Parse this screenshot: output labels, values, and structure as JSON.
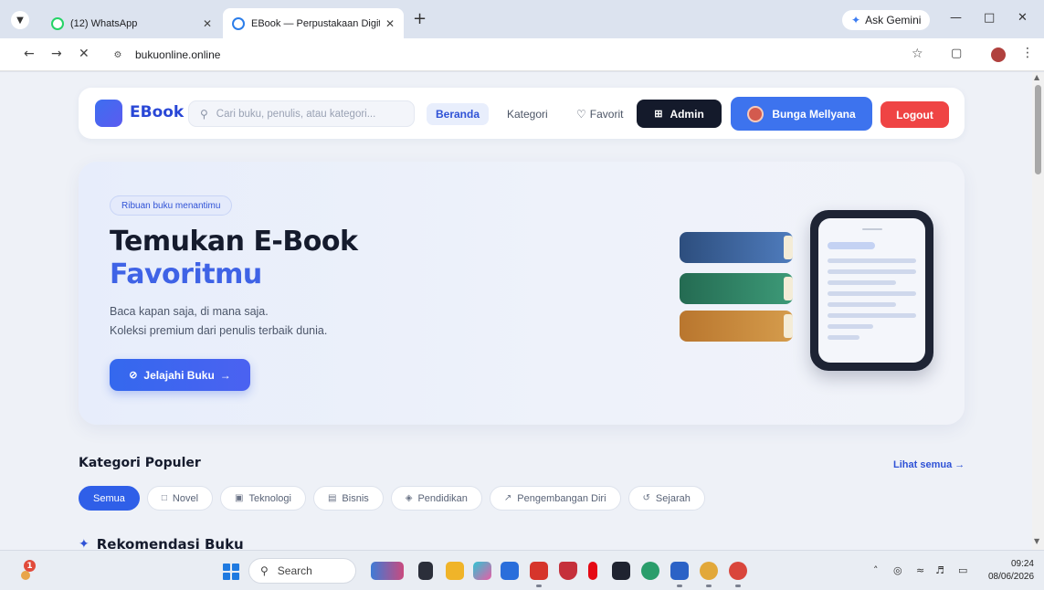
{
  "browser": {
    "tabs": [
      {
        "title": "(12) WhatsApp",
        "active": false
      },
      {
        "title": "EBook — Perpustakaan Digital",
        "active": true
      }
    ],
    "ask_gemini": "Ask Gemini",
    "url": "bukuonline.online"
  },
  "nav": {
    "logo": "EBook",
    "search_placeholder": "Cari buku, penulis, atau kategori...",
    "links": [
      "Beranda",
      "Kategori",
      "Favorit"
    ],
    "admin_label": "Admin",
    "user_label": "Bunga Mellyana",
    "logout_label": "Logout"
  },
  "hero": {
    "badge": "Ribuan buku menantimu",
    "title_line1": "Temukan E-Book",
    "title_line2": "Favoritmu",
    "subtitle_line1": "Baca kapan saja, di mana saja.",
    "subtitle_line2": "Koleksi premium dari penulis terbaik dunia.",
    "cta_label": "Jelajahi Buku",
    "book_colors": [
      "#3a5f96",
      "#2d7c60",
      "#c4853a"
    ]
  },
  "categories": {
    "title": "Kategori Populer",
    "see_all": "Lihat semua →",
    "chips": [
      {
        "label": "Semua",
        "icon": ""
      },
      {
        "label": "Novel",
        "icon": "book-icon"
      },
      {
        "label": "Teknologi",
        "icon": "chip-icon"
      },
      {
        "label": "Bisnis",
        "icon": "briefcase-icon"
      },
      {
        "label": "Pendidikan",
        "icon": "graduation-cap-icon"
      },
      {
        "label": "Pengembangan Diri",
        "icon": "trend-icon"
      },
      {
        "label": "Sejarah",
        "icon": "history-icon"
      }
    ]
  },
  "recommendations": {
    "title": "Rekomendasi Buku"
  },
  "taskbar": {
    "search_label": "Search",
    "time": "09:24",
    "date": "08/06/2026",
    "weather_badge": "1"
  }
}
